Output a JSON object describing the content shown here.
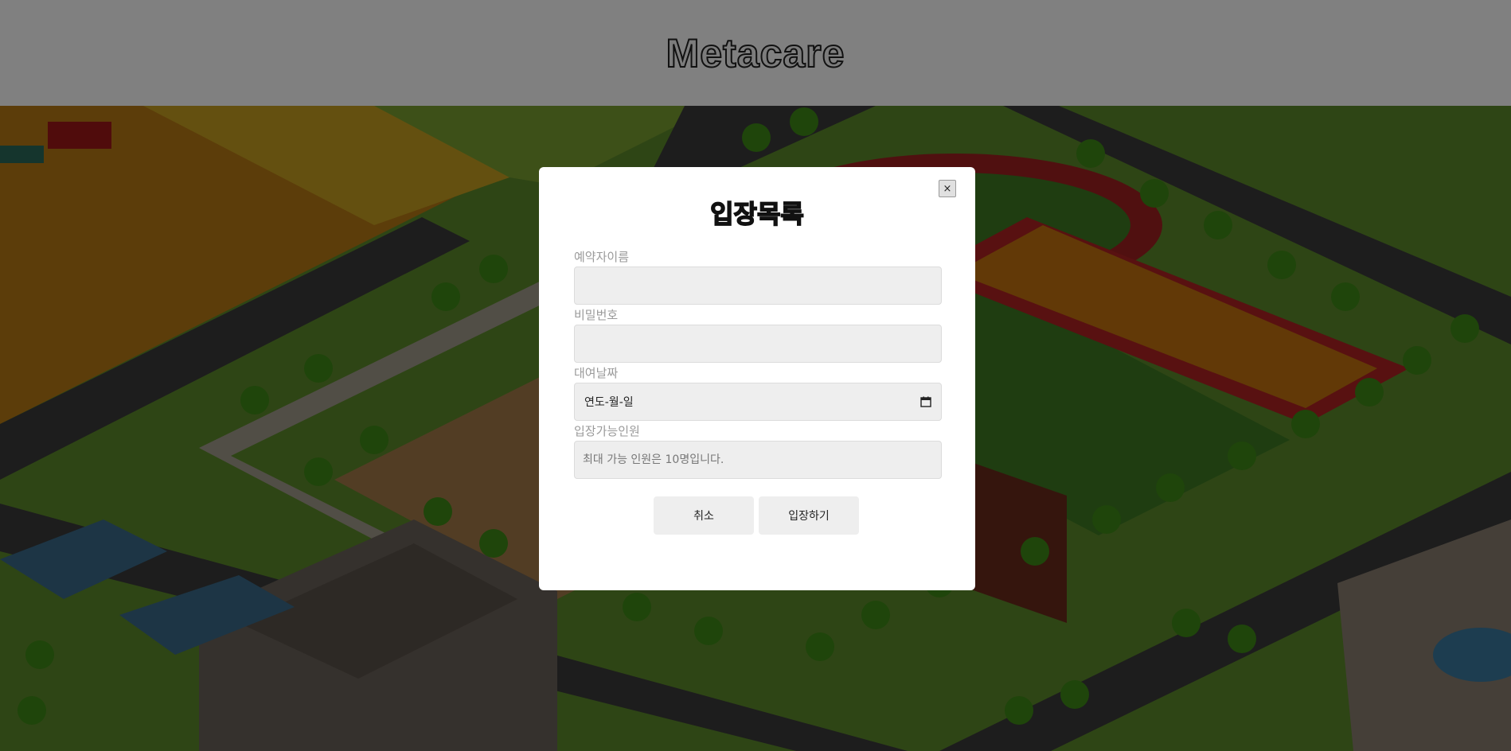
{
  "header": {
    "title": "Metacare"
  },
  "modal": {
    "title": "입장목록",
    "close_label": "×",
    "fields": [
      {
        "label": "예약자이름",
        "value": "",
        "placeholder": ""
      },
      {
        "label": "비밀번호",
        "value": "",
        "placeholder": ""
      },
      {
        "label": "대여날짜",
        "value": "연도-월-일",
        "placeholder": ""
      },
      {
        "label": "입장가능인원",
        "value": "",
        "placeholder": "최대 가능 인원은 10명입니다."
      }
    ],
    "buttons": {
      "cancel": "취소",
      "enter": "입장하기"
    }
  },
  "icons": {
    "close": "close-icon",
    "calendar": "calendar-icon"
  },
  "colors": {
    "header_bg": "#808080",
    "modal_bg": "#ffffff",
    "field_bg": "#eeeeee",
    "label": "#9a9a9a"
  }
}
